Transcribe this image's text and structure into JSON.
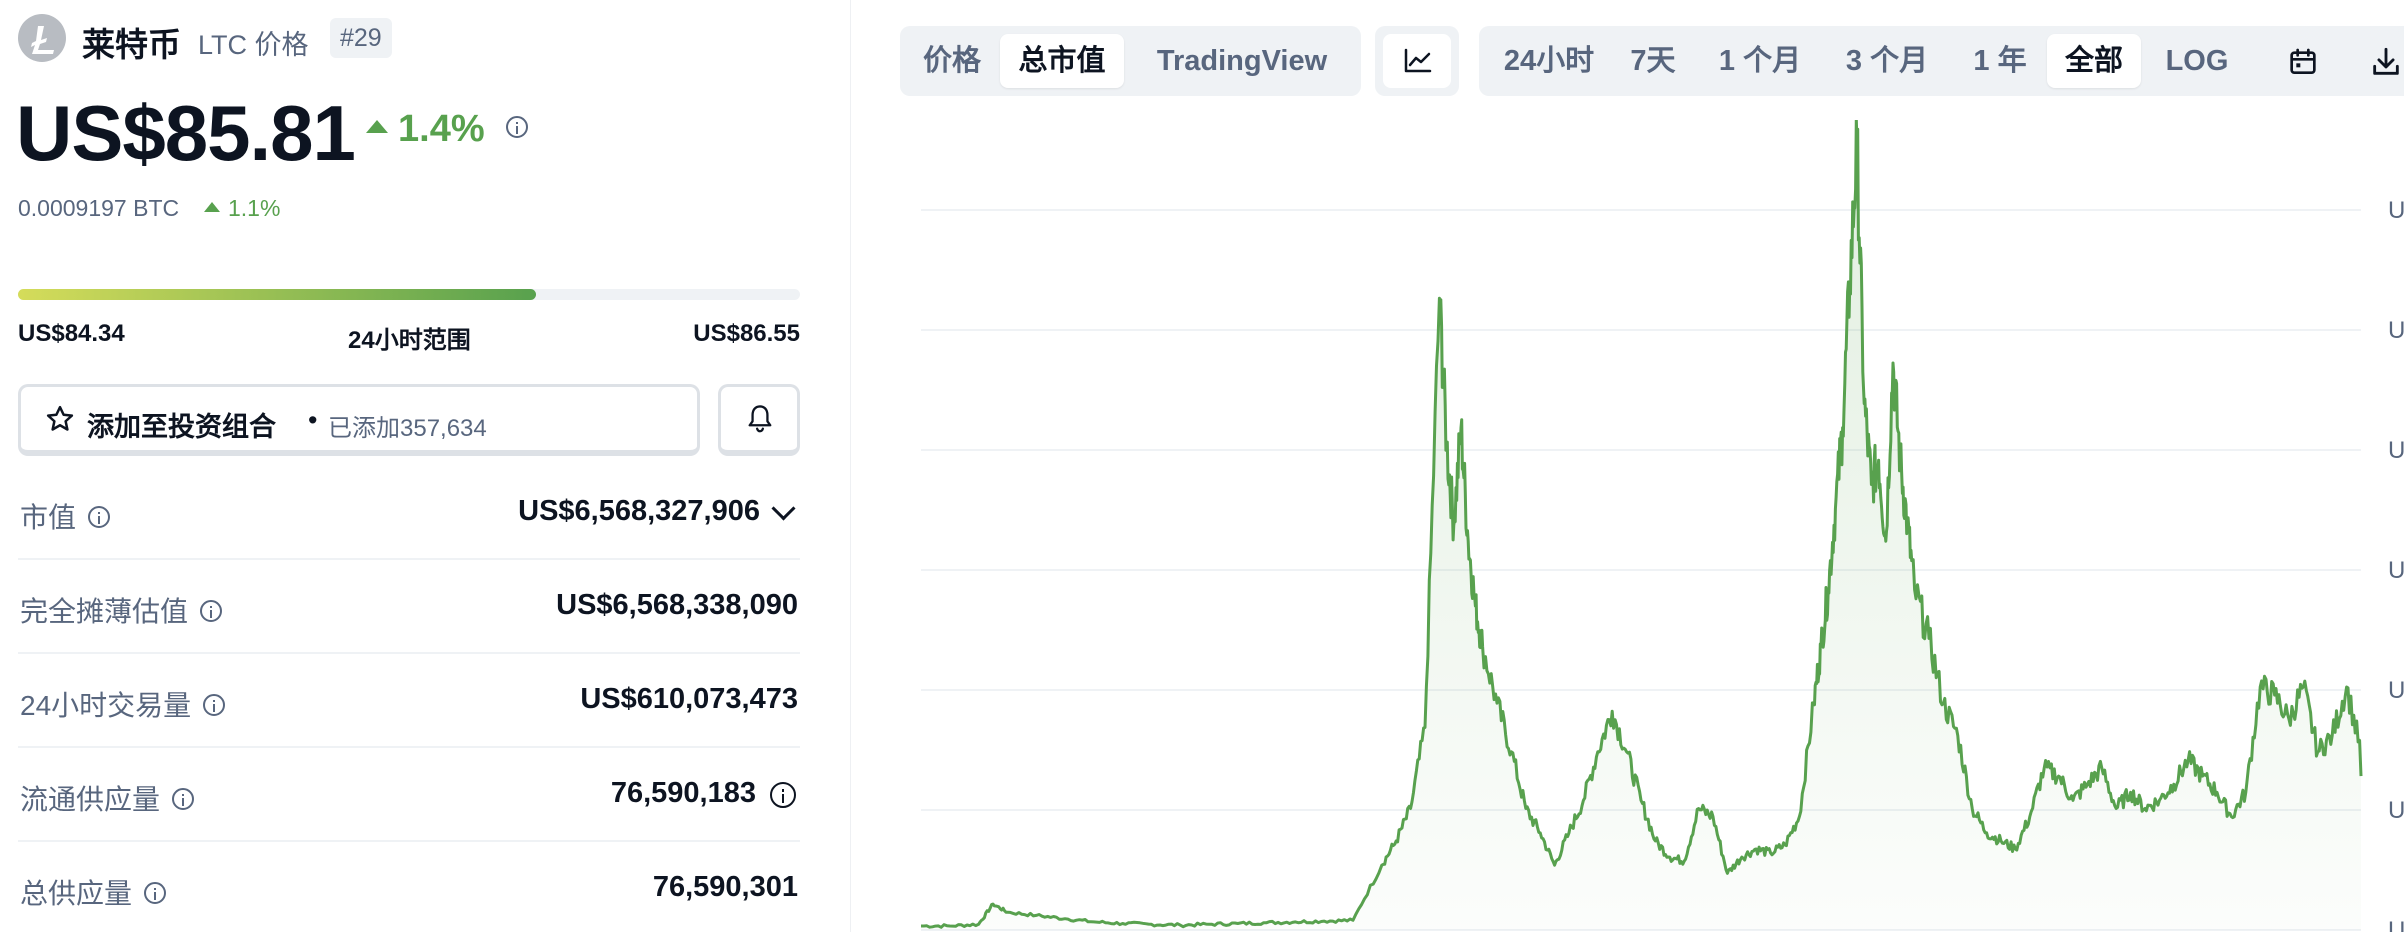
{
  "coin": {
    "name": "莱特币",
    "ticker_label": "LTC 价格",
    "rank": "#29",
    "price": "US$85.81",
    "change_24h": "1.4%",
    "btc_price": "0.0009197 BTC",
    "btc_change": "1.1%"
  },
  "range": {
    "low": "US$84.34",
    "label": "24小时范围",
    "high": "US$86.55",
    "position": 0.663
  },
  "portfolio": {
    "add_label": "添加至投资组合",
    "separator": "•",
    "added_count": "已添加357,634"
  },
  "stats": [
    {
      "label": "市值",
      "value": "US$6,568,327,906"
    },
    {
      "label": "完全摊薄估值",
      "value": "US$6,568,338,090"
    },
    {
      "label": "24小时交易量",
      "value": "US$610,073,473"
    },
    {
      "label": "流通供应量",
      "value": "76,590,183"
    },
    {
      "label": "总供应量",
      "value": "76,590,301"
    }
  ],
  "chart_tabs": {
    "view": [
      {
        "label": "价格",
        "active": false
      },
      {
        "label": "总市值",
        "active": true
      },
      {
        "label": "TradingView",
        "active": false
      }
    ],
    "ranges": [
      {
        "label": "24小时",
        "active": false
      },
      {
        "label": "7天",
        "active": false
      },
      {
        "label": "1 个月",
        "active": false
      },
      {
        "label": "3 个月",
        "active": false
      },
      {
        "label": "1 年",
        "active": false
      },
      {
        "label": "全部",
        "active": true
      },
      {
        "label": "LOG",
        "active": false
      }
    ]
  },
  "colors": {
    "accent_green": "#58a14e",
    "text_primary": "#0d1421",
    "text_secondary": "#58667e",
    "tab_bg": "#eff2f5"
  },
  "chart_data": {
    "type": "area",
    "title": "",
    "xlabel": "",
    "ylabel": "",
    "y_tick_labels": [
      "U",
      "U",
      "U",
      "U",
      "U",
      "U",
      "U"
    ],
    "grid": true,
    "color": "#58a14e",
    "x": [
      0,
      2,
      4,
      5,
      6,
      8,
      10,
      12,
      14,
      16,
      18,
      20,
      22,
      24,
      26,
      28,
      30,
      32,
      33,
      34,
      35,
      36,
      36.5,
      37,
      37.5,
      38,
      38.5,
      39,
      40,
      41,
      42,
      43,
      44,
      45,
      46,
      47,
      48,
      49,
      50,
      51,
      52,
      53,
      54,
      55,
      56,
      57,
      58,
      59,
      60,
      61,
      62,
      62.5,
      63,
      63.5,
      64,
      64.5,
      65,
      65.5,
      66,
      66.5,
      67,
      67.5,
      68,
      68.5,
      69,
      70,
      71,
      72,
      73,
      74,
      75,
      76,
      77,
      78,
      79,
      80,
      81,
      82,
      83,
      84,
      85,
      86,
      87,
      88,
      89,
      90,
      91,
      92,
      93,
      94,
      95,
      96,
      97,
      98,
      99,
      100
    ],
    "values": [
      0.5,
      0.5,
      0.7,
      3.2,
      2.2,
      1.8,
      1.4,
      1.0,
      0.8,
      0.7,
      0.6,
      0.7,
      0.8,
      0.9,
      1.0,
      1.1,
      1.2,
      8.0,
      11.0,
      15.0,
      25.0,
      78.0,
      60.0,
      50.0,
      62.0,
      48.0,
      40.0,
      35.0,
      28.0,
      22.0,
      15.0,
      12.0,
      8.0,
      12.0,
      16.0,
      22.0,
      27.0,
      22.0,
      16.0,
      11.0,
      9.0,
      8.5,
      15.0,
      14.0,
      7.0,
      9.0,
      10.0,
      9.5,
      10.5,
      14.0,
      28.0,
      35.0,
      42.0,
      52.0,
      62.0,
      80.0,
      97.0,
      65.0,
      55.0,
      58.0,
      48.0,
      70.0,
      58.0,
      50.0,
      42.0,
      36.0,
      28.0,
      24.0,
      15.0,
      12.0,
      11.0,
      10.0,
      14.0,
      20.0,
      19.0,
      16.0,
      18.0,
      20.0,
      15.0,
      17.0,
      15.0,
      16.0,
      18.0,
      21.0,
      19.0,
      17.0,
      14.0,
      17.0,
      30.0,
      29.0,
      26.0,
      30.0,
      22.0,
      24.0,
      30.0,
      22.0,
      19.0
    ],
    "ylim": [
      0,
      100
    ]
  }
}
